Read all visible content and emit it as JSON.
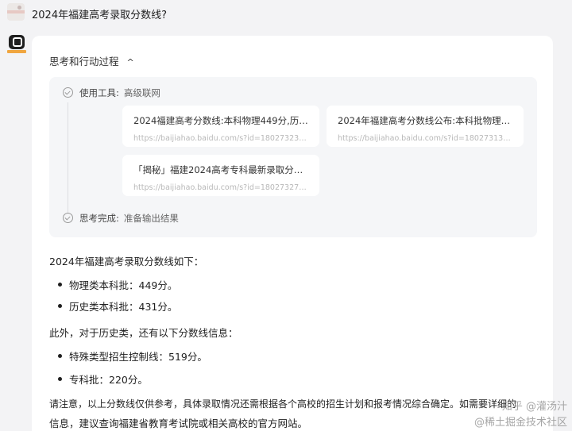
{
  "question": "2024年福建高考录取分数线?",
  "thinking": {
    "header": "思考和行动过程",
    "chevron": "^",
    "tool_step": {
      "key": "使用工具:",
      "value": "高级联网"
    },
    "references": [
      {
        "title": "2024福建高考分数线:本科物理449分,历史...",
        "url": "https://baijiahao.baidu.com/s?id=1802732303824..."
      },
      {
        "title": "2024年福建高考分数线公布:本科批物理组...",
        "url": "https://baijiahao.baidu.com/s?id=180273135911 7..."
      },
      {
        "title": "「揭秘」福建2024高考专科最新录取分数...",
        "url": "https://baijiahao.baidu.com/s?id=1802732724073..."
      }
    ],
    "done_step": {
      "key": "思考完成:",
      "value": "准备输出结果"
    }
  },
  "answer": {
    "intro": "2024年福建高考录取分数线如下：",
    "list1": [
      "物理类本科批：449分。",
      "历史类本科批：431分。"
    ],
    "intro2": "此外，对于历史类，还有以下分数线信息：",
    "list2": [
      "特殊类型招生控制线：519分。",
      "专科批：220分。"
    ],
    "note_line1": "请注意，以上分数线仅供参考，具体录取情况还需根据各个高校的招生计划和报考情况综合确定。如需要详细的",
    "note_line2": "信息，建议查询福建省教育考试院或相关高校的官方网站。"
  },
  "watermark": {
    "line1": "知乎 @灌汤汁",
    "line2": "@稀土掘金技术社区"
  }
}
